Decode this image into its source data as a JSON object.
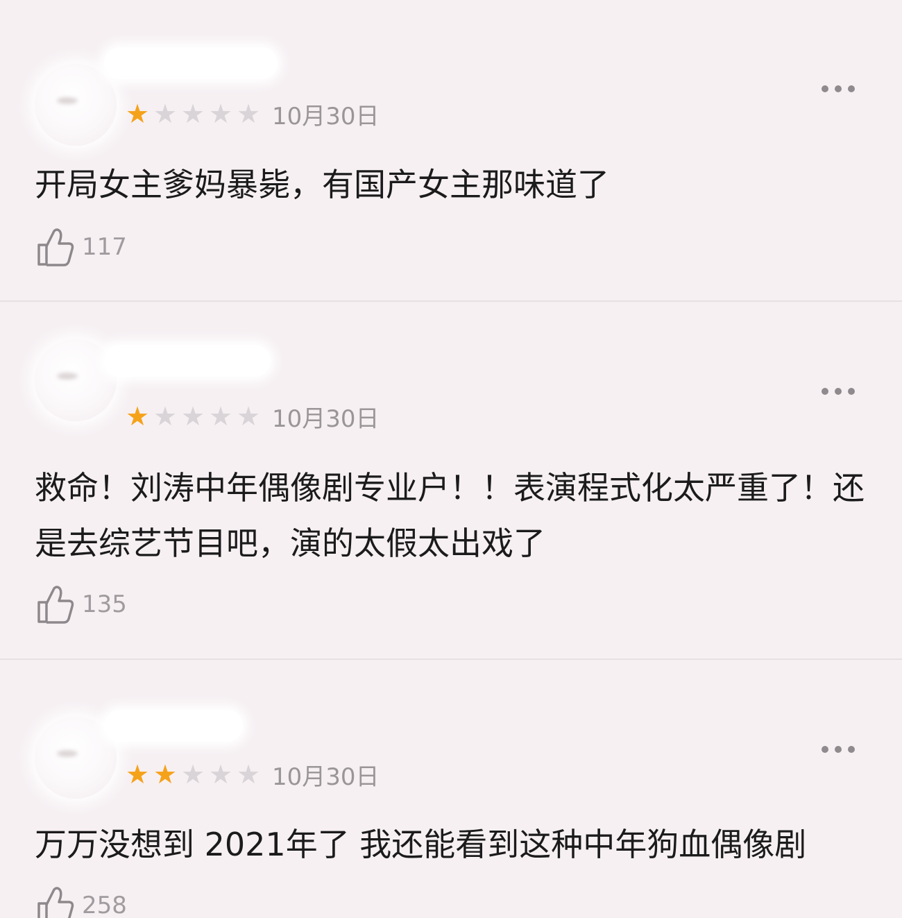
{
  "reviews": [
    {
      "rating": 1,
      "max_rating": 5,
      "date": "10月30日",
      "text": "开局女主爹妈暴毙，有国产女主那味道了",
      "likes": "117",
      "icons": {
        "like": "thumbs-up-icon",
        "more": "more-dots-icon"
      }
    },
    {
      "rating": 1,
      "max_rating": 5,
      "date": "10月30日",
      "text": "救命！刘涛中年偶像剧专业户！！表演程式化太严重了！还是去综艺节目吧，演的太假太出戏了",
      "likes": "135",
      "icons": {
        "like": "thumbs-up-icon",
        "more": "more-dots-icon"
      }
    },
    {
      "rating": 2,
      "max_rating": 5,
      "date": "10月30日",
      "text": "万万没想到 2021年了 我还能看到这种中年狗血偶像剧",
      "likes": "258",
      "icons": {
        "like": "thumbs-up-icon",
        "more": "more-dots-icon"
      }
    }
  ],
  "colors": {
    "background": "#f6f0f3",
    "star_on": "#f5a21b",
    "star_off": "#d9d4d7",
    "meta_text": "#9a9597",
    "body_text": "#1b1b1b"
  }
}
